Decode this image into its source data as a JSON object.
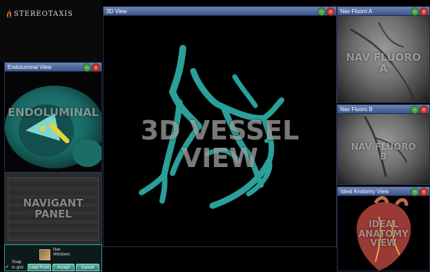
{
  "logo": {
    "text": "STEREOTAXIS"
  },
  "panels": {
    "endoluminal": {
      "title": "Endoluminal View",
      "overlay_line1": "ENDOLUMINAL"
    },
    "navigant": {
      "overlay_line1": "NAVIGANT",
      "overlay_line2": "PANEL"
    },
    "view3d": {
      "title": "3D View",
      "overlay_line1": "3D VESSEL",
      "overlay_line2": "VIEW"
    },
    "fluoro_a": {
      "title": "Nav Fluoro A",
      "overlay_line1": "NAV FLUORO",
      "overlay_line2": "A"
    },
    "fluoro_b": {
      "title": "Nav Fluoro B",
      "overlay_line1": "NAV FLUORO",
      "overlay_line2": "B"
    },
    "anatomy": {
      "title": "Ideal Anatomy View",
      "overlay_line1": "IDEAL",
      "overlay_line2": "ANATOMY",
      "overlay_line3": "VIEW"
    }
  },
  "nav_windows": {
    "line1": "Nav",
    "line2": "Windows"
  },
  "snap": {
    "line1": "Snap",
    "line2": "to grid",
    "checked": true
  },
  "buttons": {
    "load_from": "Load From",
    "accept": "Accept",
    "cancel": "Cancel"
  },
  "colors": {
    "vessel": "#2ea8a2",
    "titlebar": "#4a64a0",
    "button": "#3e9a8a"
  }
}
